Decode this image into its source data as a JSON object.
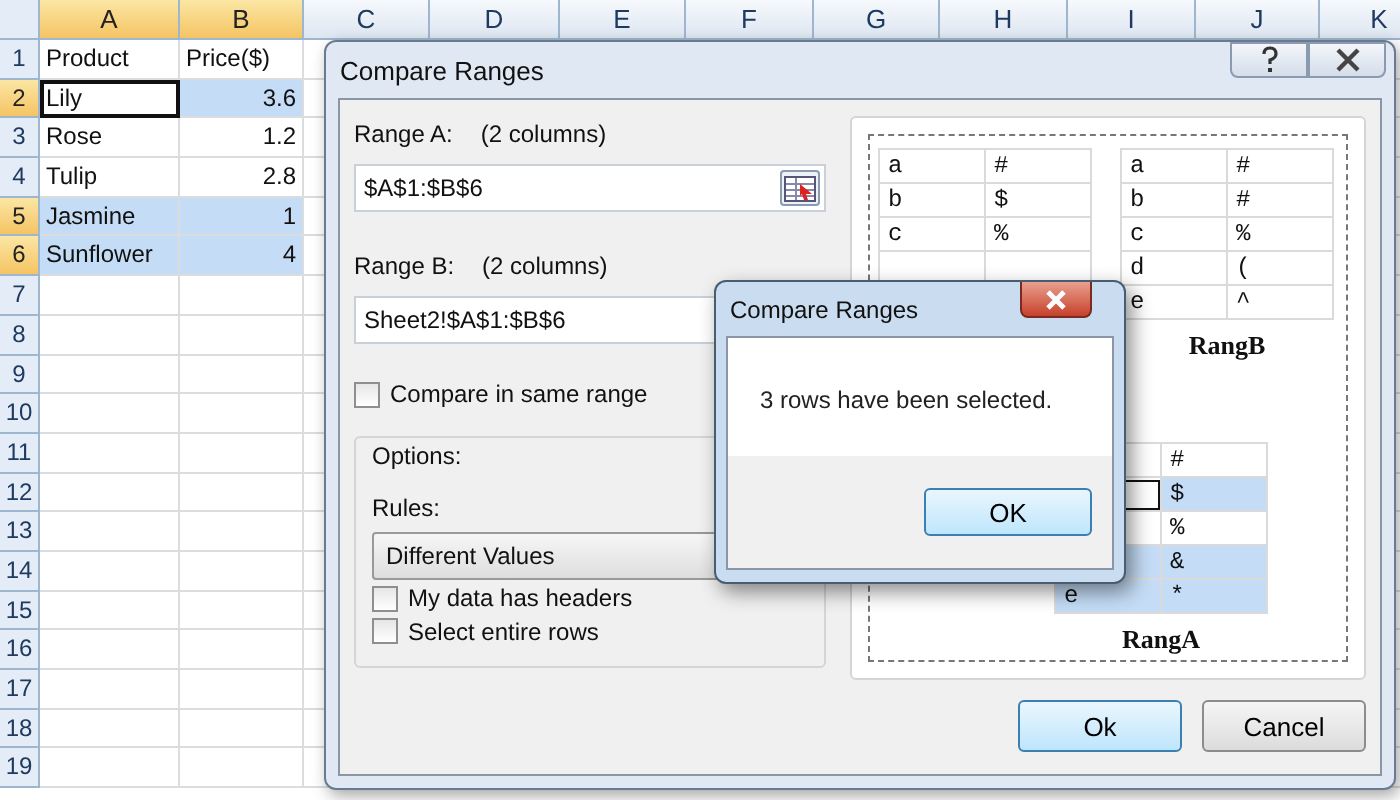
{
  "sheet": {
    "columns": [
      {
        "label": "A",
        "selected": true
      },
      {
        "label": "B",
        "selected": true
      },
      {
        "label": "C",
        "selected": false
      },
      {
        "label": "D",
        "selected": false
      },
      {
        "label": "E",
        "selected": false
      },
      {
        "label": "F",
        "selected": false
      },
      {
        "label": "G",
        "selected": false
      },
      {
        "label": "H",
        "selected": false
      },
      {
        "label": "I",
        "selected": false
      },
      {
        "label": "J",
        "selected": false
      },
      {
        "label": "K",
        "selected": false
      }
    ],
    "rows": [
      {
        "number": "1",
        "selected": false,
        "cells": [
          {
            "text": "Product",
            "selected": false,
            "active": false,
            "kind": "text"
          },
          {
            "text": "Price($)",
            "selected": false,
            "active": false,
            "kind": "text"
          }
        ]
      },
      {
        "number": "2",
        "selected": true,
        "cells": [
          {
            "text": "Lily",
            "selected": false,
            "active": true,
            "kind": "text"
          },
          {
            "text": "3.6",
            "selected": true,
            "active": false,
            "kind": "number"
          }
        ]
      },
      {
        "number": "3",
        "selected": false,
        "cells": [
          {
            "text": "Rose",
            "selected": false,
            "active": false,
            "kind": "text"
          },
          {
            "text": "1.2",
            "selected": false,
            "active": false,
            "kind": "number"
          }
        ]
      },
      {
        "number": "4",
        "selected": false,
        "cells": [
          {
            "text": "Tulip",
            "selected": false,
            "active": false,
            "kind": "text"
          },
          {
            "text": "2.8",
            "selected": false,
            "active": false,
            "kind": "number"
          }
        ]
      },
      {
        "number": "5",
        "selected": true,
        "cells": [
          {
            "text": "Jasmine",
            "selected": true,
            "active": false,
            "kind": "text"
          },
          {
            "text": "1",
            "selected": true,
            "active": false,
            "kind": "number"
          }
        ]
      },
      {
        "number": "6",
        "selected": true,
        "cells": [
          {
            "text": "Sunflower",
            "selected": true,
            "active": false,
            "kind": "text"
          },
          {
            "text": "4",
            "selected": true,
            "active": false,
            "kind": "number"
          }
        ]
      },
      {
        "number": "7",
        "selected": false
      },
      {
        "number": "8",
        "selected": false
      },
      {
        "number": "9",
        "selected": false
      },
      {
        "number": "10",
        "selected": false
      },
      {
        "number": "11",
        "selected": false
      },
      {
        "number": "12",
        "selected": false
      },
      {
        "number": "13",
        "selected": false
      },
      {
        "number": "14",
        "selected": false
      },
      {
        "number": "15",
        "selected": false
      },
      {
        "number": "16",
        "selected": false
      },
      {
        "number": "17",
        "selected": false
      },
      {
        "number": "18",
        "selected": false
      },
      {
        "number": "19",
        "selected": false
      }
    ]
  },
  "dialog": {
    "title": "Compare Ranges",
    "range_a": {
      "label": "Range A:",
      "note": "(2 columns)",
      "value": "$A$1:$B$6"
    },
    "range_b": {
      "label": "Range B:",
      "note": "(2 columns)",
      "value": "Sheet2!$A$1:$B$6"
    },
    "same_range": {
      "label": "Compare in same range",
      "checked": false
    },
    "options": {
      "title": "Options:",
      "rules_label": "Rules:",
      "rule": "Different Values",
      "checkboxes": [
        {
          "label": "My data has headers",
          "checked": false
        },
        {
          "label": "Select entire rows",
          "checked": false
        }
      ]
    },
    "preview": {
      "table_1": {
        "rows": [
          [
            {
              "text": "a",
              "selected": false,
              "active": false
            },
            {
              "text": "#",
              "selected": false,
              "active": false
            }
          ],
          [
            {
              "text": "b",
              "selected": false,
              "active": false
            },
            {
              "text": "$",
              "selected": false,
              "active": false
            }
          ],
          [
            {
              "text": "c",
              "selected": false,
              "active": false
            },
            {
              "text": "%",
              "selected": false,
              "active": false
            }
          ]
        ]
      },
      "range_b": {
        "caption": "RangB",
        "rows": [
          [
            {
              "text": "a",
              "selected": false,
              "active": false
            },
            {
              "text": "#",
              "selected": false,
              "active": false
            }
          ],
          [
            {
              "text": "b",
              "selected": false,
              "active": false
            },
            {
              "text": "#",
              "selected": false,
              "active": false
            }
          ],
          [
            {
              "text": "c",
              "selected": false,
              "active": false
            },
            {
              "text": "%",
              "selected": false,
              "active": false
            }
          ],
          [
            {
              "text": "d",
              "selected": false,
              "active": false
            },
            {
              "text": "(",
              "selected": false,
              "active": false
            }
          ],
          [
            {
              "text": "e",
              "selected": false,
              "active": false
            },
            {
              "text": "^",
              "selected": false,
              "active": false
            }
          ]
        ]
      },
      "range_a": {
        "caption": "RangA",
        "rows": [
          [
            {
              "text": "",
              "selected": false,
              "active": false
            },
            {
              "text": "#",
              "selected": false,
              "active": false
            }
          ],
          [
            {
              "text": "",
              "selected": false,
              "active": true
            },
            {
              "text": "$",
              "selected": true,
              "active": false
            }
          ],
          [
            {
              "text": "",
              "selected": false,
              "active": false
            },
            {
              "text": "%",
              "selected": false,
              "active": false
            }
          ],
          [
            {
              "text": "",
              "selected": true,
              "active": false
            },
            {
              "text": "&",
              "selected": true,
              "active": false
            }
          ],
          [
            {
              "text": "e",
              "selected": true,
              "active": false
            },
            {
              "text": "*",
              "selected": true,
              "active": false
            }
          ]
        ]
      }
    },
    "buttons": [
      {
        "label": "Ok",
        "selected": true
      },
      {
        "label": "Cancel",
        "selected": false
      }
    ]
  },
  "message": {
    "title": "Compare Ranges",
    "text": "3 rows have been selected.",
    "button": "OK"
  }
}
